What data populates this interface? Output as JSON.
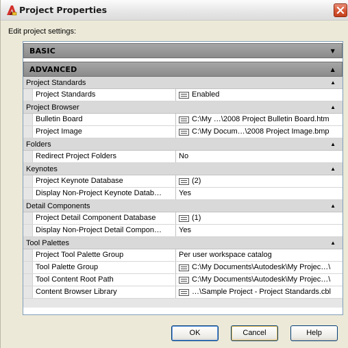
{
  "window": {
    "title": "Project Properties"
  },
  "edit_label": "Edit project settings:",
  "sections": {
    "basic": {
      "label": "BASIC",
      "collapsed": true
    },
    "advanced": {
      "label": "ADVANCED",
      "collapsed": false
    }
  },
  "categories": [
    {
      "label": "Project Standards",
      "rows": [
        {
          "name": "Project Standards",
          "value": "Enabled",
          "has_icon": true
        }
      ]
    },
    {
      "label": "Project Browser",
      "rows": [
        {
          "name": "Bulletin Board",
          "value": "C:\\My …\\2008 Project Bulletin Board.htm",
          "has_icon": true
        },
        {
          "name": "Project Image",
          "value": "C:\\My Docum…\\2008 Project Image.bmp",
          "has_icon": true
        }
      ]
    },
    {
      "label": "Folders",
      "rows": [
        {
          "name": "Redirect Project Folders",
          "value": "No",
          "has_icon": false
        }
      ]
    },
    {
      "label": "Keynotes",
      "rows": [
        {
          "name": "Project Keynote Database",
          "value": "(2)",
          "has_icon": true
        },
        {
          "name": "Display Non-Project Keynote Datab…",
          "value": "Yes",
          "has_icon": false
        }
      ]
    },
    {
      "label": "Detail Components",
      "rows": [
        {
          "name": "Project Detail Component Database",
          "value": "(1)",
          "has_icon": true
        },
        {
          "name": "Display Non-Project Detail Compon…",
          "value": "Yes",
          "has_icon": false
        }
      ]
    },
    {
      "label": "Tool Palettes",
      "rows": [
        {
          "name": "Project Tool Palette Group",
          "value": "Per user workspace catalog",
          "has_icon": false
        },
        {
          "name": "Tool Palette Group",
          "value": "C:\\My Documents\\Autodesk\\My Projec…\\",
          "has_icon": true
        },
        {
          "name": "Tool Content Root Path",
          "value": "C:\\My Documents\\Autodesk\\My Projec…\\",
          "has_icon": true
        },
        {
          "name": "Content Browser Library",
          "value": "…\\Sample Project - Project Standards.cbl",
          "has_icon": true
        }
      ]
    }
  ],
  "buttons": {
    "ok": "OK",
    "cancel": "Cancel",
    "help": "Help"
  },
  "icons": {
    "app": "autodesk-a-icon",
    "close": "close-icon",
    "collapse": "collapse-arrow-icon",
    "expand": "expand-arrow-icon",
    "value_editor": "list-editor-icon"
  },
  "colors": {
    "close_button": "#d55432",
    "section_header": "#999999",
    "category_row": "#d9d9d9",
    "grid_border": "#7f9db9",
    "window_bg": "#ece9d8"
  }
}
